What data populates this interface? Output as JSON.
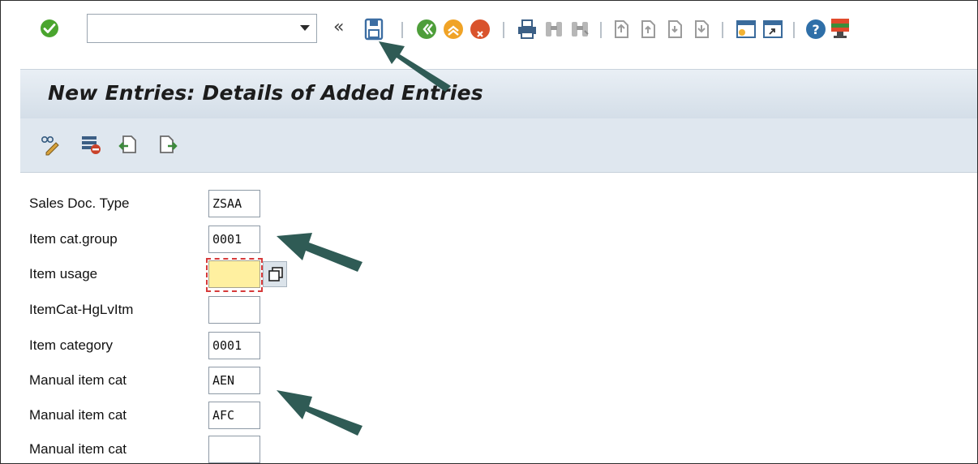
{
  "toolbar": {
    "command_field": {
      "value": "",
      "placeholder": ""
    },
    "collapse_glyph": "«",
    "icons": [
      "enter-icon",
      "save-icon",
      "back-icon",
      "exit-icon",
      "cancel-icon",
      "print-icon",
      "find-icon",
      "find-next-icon",
      "first-page-icon",
      "previous-page-icon",
      "next-page-icon",
      "last-page-icon",
      "create-session-icon",
      "shortcut-icon",
      "help-icon",
      "customize-layout-icon"
    ]
  },
  "title": "New Entries: Details of Added Entries",
  "app_toolbar": {
    "icons": [
      "display-change-icon",
      "delete-icon",
      "previous-entry-icon",
      "next-entry-icon"
    ]
  },
  "form": {
    "rows": [
      {
        "label": "Sales Doc. Type",
        "value": "ZSAA"
      },
      {
        "label": "Item cat.group",
        "value": "0001"
      },
      {
        "label": "Item usage",
        "value": ""
      },
      {
        "label": "ItemCat-HgLvItm",
        "value": ""
      },
      {
        "label": "Item category",
        "value": "0001"
      },
      {
        "label": "Manual item cat",
        "value": "AEN"
      },
      {
        "label": "Manual item cat",
        "value": "AFC"
      },
      {
        "label": "Manual item cat",
        "value": ""
      }
    ]
  },
  "colors": {
    "arrow": "#2f5b55",
    "title_bg": "#dce5ee",
    "focus_field": "#fff0a0",
    "focus_border": "#d63a3a"
  }
}
